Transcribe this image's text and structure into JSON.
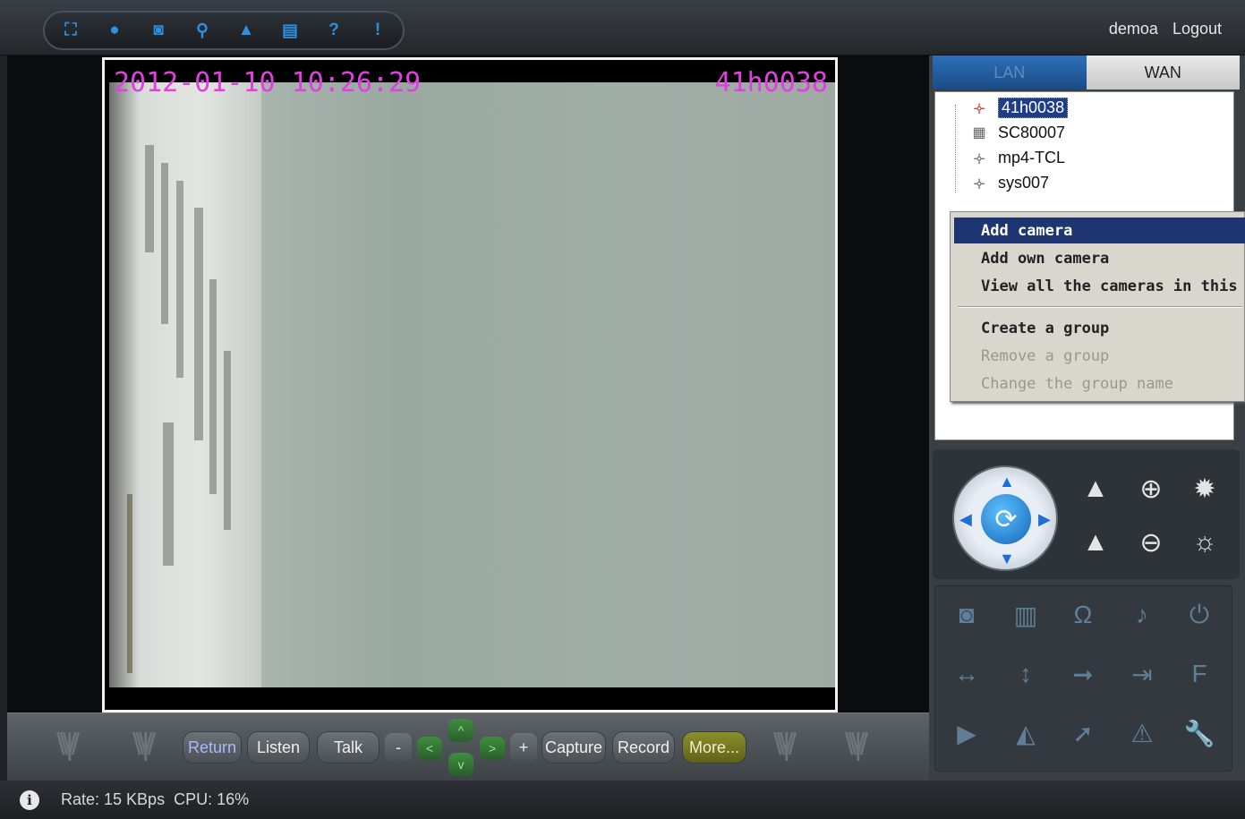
{
  "toolbar": {
    "icons": [
      {
        "name": "fullscreen-icon",
        "glyph": "⛶"
      },
      {
        "name": "record-icon",
        "glyph": "●"
      },
      {
        "name": "camera-icon",
        "glyph": "◙"
      },
      {
        "name": "search-icon",
        "glyph": "⚲"
      },
      {
        "name": "lock-icon",
        "glyph": "▲"
      },
      {
        "name": "save-icon",
        "glyph": "▤"
      },
      {
        "name": "help-icon",
        "glyph": "?"
      },
      {
        "name": "about-icon",
        "glyph": "!"
      }
    ]
  },
  "user": {
    "name": "demoa",
    "logout_label": "Logout"
  },
  "video": {
    "timestamp": "2012-01-10 10:26:29",
    "camera_id": "41h0038"
  },
  "controls": {
    "return": "Return",
    "listen": "Listen",
    "talk": "Talk",
    "minus": "-",
    "plus": "+",
    "up": "^",
    "down": "v",
    "left": "<",
    "right": ">",
    "capture": "Capture",
    "record": "Record",
    "more": "More..."
  },
  "status": {
    "rate": "Rate: 15 KBps",
    "cpu": "CPU:  16%"
  },
  "tabs": {
    "lan": "LAN",
    "wan": "WAN"
  },
  "tree": {
    "nodes": [
      {
        "label": "41h0038",
        "icon": "camera-icon",
        "glyph": "🝊"
      },
      {
        "label": "SC80007",
        "icon": "network-camera-icon",
        "glyph": "▦"
      },
      {
        "label": "mp4-TCL",
        "icon": "camera-icon",
        "glyph": "🝊"
      },
      {
        "label": "sys007",
        "icon": "camera-icon",
        "glyph": "🝊"
      }
    ]
  },
  "context_menu": {
    "items": [
      {
        "label": "Add camera",
        "state": "active"
      },
      {
        "label": "Add own camera",
        "state": "normal"
      },
      {
        "label": "View all the cameras in this",
        "state": "normal"
      },
      {
        "label": "Create a group",
        "state": "normal"
      },
      {
        "label": "Remove a group",
        "state": "disabled"
      },
      {
        "label": "Change the group name",
        "state": "disabled"
      }
    ]
  },
  "ptz": {
    "buttons": [
      {
        "name": "focus-in-icon",
        "glyph": "▲"
      },
      {
        "name": "zoom-in-icon",
        "glyph": "⊕"
      },
      {
        "name": "brightness-up-icon",
        "glyph": "✹"
      },
      {
        "name": "focus-out-icon",
        "glyph": "▲"
      },
      {
        "name": "zoom-out-icon",
        "glyph": "⊖"
      },
      {
        "name": "brightness-down-icon",
        "glyph": "☼"
      }
    ]
  },
  "functions": {
    "buttons": [
      {
        "name": "snapshot-icon",
        "glyph": "◙"
      },
      {
        "name": "clapper-icon",
        "glyph": "▥"
      },
      {
        "name": "headphones-icon",
        "glyph": "Ω"
      },
      {
        "name": "microphone-icon",
        "glyph": "♪"
      },
      {
        "name": "power-icon",
        "glyph": "⏻"
      },
      {
        "name": "horizontal-flip-icon",
        "glyph": "↔"
      },
      {
        "name": "vertical-flip-icon",
        "glyph": "↕"
      },
      {
        "name": "move-right-icon",
        "glyph": "➞"
      },
      {
        "name": "login-icon",
        "glyph": "⇥"
      },
      {
        "name": "f-icon",
        "glyph": "F"
      },
      {
        "name": "play-icon",
        "glyph": "▶"
      },
      {
        "name": "mirror-icon",
        "glyph": "◭"
      },
      {
        "name": "trend-icon",
        "glyph": "➚"
      },
      {
        "name": "warning-icon",
        "glyph": "⚠"
      },
      {
        "name": "wrench-icon",
        "glyph": "🔧"
      }
    ]
  }
}
